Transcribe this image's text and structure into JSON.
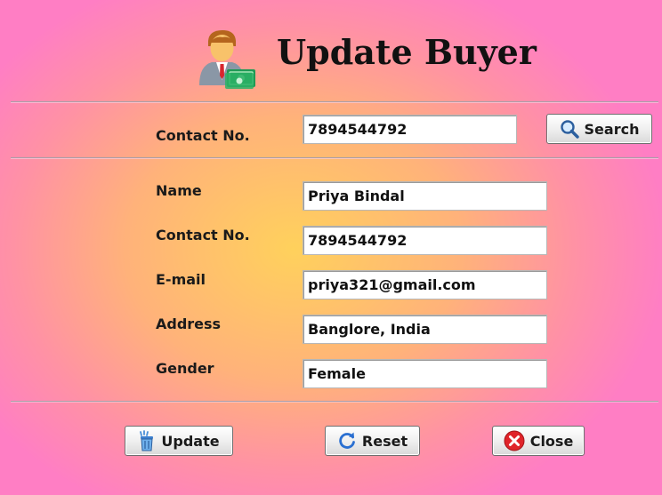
{
  "header": {
    "title": "Update Buyer",
    "icon": "buyer-money-icon"
  },
  "search": {
    "label": "Contact No.",
    "value": "7894544792",
    "button_label": "Search",
    "button_icon": "magnifier-icon"
  },
  "form": {
    "name_label": "Name",
    "name_value": "Priya Bindal",
    "contact_label": "Contact No.",
    "contact_value": "7894544792",
    "email_label": "E-mail",
    "email_value": "priya321@gmail.com",
    "address_label": "Address",
    "address_value": "Banglore, India",
    "gender_label": "Gender",
    "gender_value": "Female"
  },
  "actions": {
    "update_label": "Update",
    "update_icon": "update-trash-icon",
    "reset_label": "Reset",
    "reset_icon": "refresh-icon",
    "close_label": "Close",
    "close_icon": "close-circle-icon"
  },
  "colors": {
    "background_center": "#ffd15c",
    "background_edge": "#ff7ec4",
    "close_red": "#e0242a",
    "reset_blue": "#2a6fd1"
  }
}
